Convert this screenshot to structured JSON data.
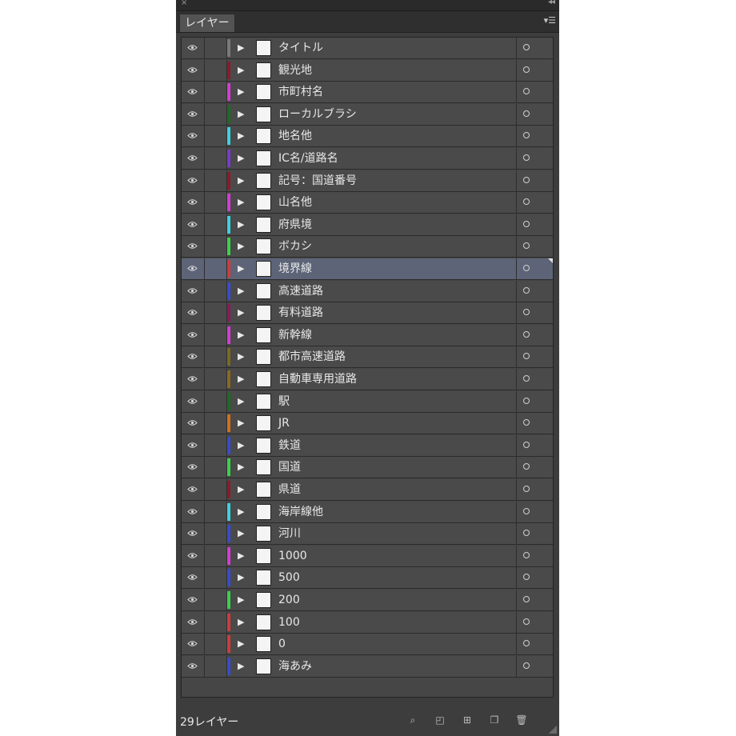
{
  "panel": {
    "tab_label": "レイヤー",
    "layer_count": "29レイヤー"
  },
  "layers": [
    {
      "name": "タイトル",
      "color": "#7a7a7a",
      "selected": false
    },
    {
      "name": "観光地",
      "color": "#8b1b2c",
      "selected": false
    },
    {
      "name": "市町村名",
      "color": "#d43cd6",
      "selected": false
    },
    {
      "name": "ローカルブラシ",
      "color": "#1d6b23",
      "selected": false
    },
    {
      "name": "地名他",
      "color": "#3ad2e0",
      "selected": false
    },
    {
      "name": "IC名/道路名",
      "color": "#7a3ad0",
      "selected": false
    },
    {
      "name": "記号：国道番号",
      "color": "#8b1b2c",
      "selected": false
    },
    {
      "name": "山名他",
      "color": "#d43cd6",
      "selected": false
    },
    {
      "name": "府県境",
      "color": "#3ad2e0",
      "selected": false
    },
    {
      "name": "ボカシ",
      "color": "#3ad24a",
      "selected": false
    },
    {
      "name": "境界線",
      "color": "#d23a3a",
      "selected": true
    },
    {
      "name": "高速道路",
      "color": "#3a4ad2",
      "selected": false
    },
    {
      "name": "有料道路",
      "color": "#8b1b5a",
      "selected": false
    },
    {
      "name": "新幹線",
      "color": "#d43cd6",
      "selected": false
    },
    {
      "name": "都市高速道路",
      "color": "#7a6a20",
      "selected": false
    },
    {
      "name": "自動車専用道路",
      "color": "#8a6a20",
      "selected": false
    },
    {
      "name": "駅",
      "color": "#1d6b23",
      "selected": false
    },
    {
      "name": "JR",
      "color": "#d2701a",
      "selected": false
    },
    {
      "name": "鉄道",
      "color": "#3a4ad2",
      "selected": false
    },
    {
      "name": "国道",
      "color": "#3ad24a",
      "selected": false
    },
    {
      "name": "県道",
      "color": "#8b1b2c",
      "selected": false
    },
    {
      "name": "海岸線他",
      "color": "#3ad2e0",
      "selected": false
    },
    {
      "name": "河川",
      "color": "#3a4ad2",
      "selected": false
    },
    {
      "name": "1000",
      "color": "#d43cd6",
      "selected": false
    },
    {
      "name": "500",
      "color": "#3a4ad2",
      "selected": false
    },
    {
      "name": "200",
      "color": "#3ad24a",
      "selected": false
    },
    {
      "name": "100",
      "color": "#d23a3a",
      "selected": false
    },
    {
      "name": "0",
      "color": "#d23a3a",
      "selected": false
    },
    {
      "name": "海あみ",
      "color": "#3a4ad2",
      "selected": false
    }
  ],
  "footer_icons": [
    "locate-object-icon",
    "make-clipping-mask-icon",
    "create-sublayer-icon",
    "new-layer-icon",
    "trash-icon"
  ]
}
